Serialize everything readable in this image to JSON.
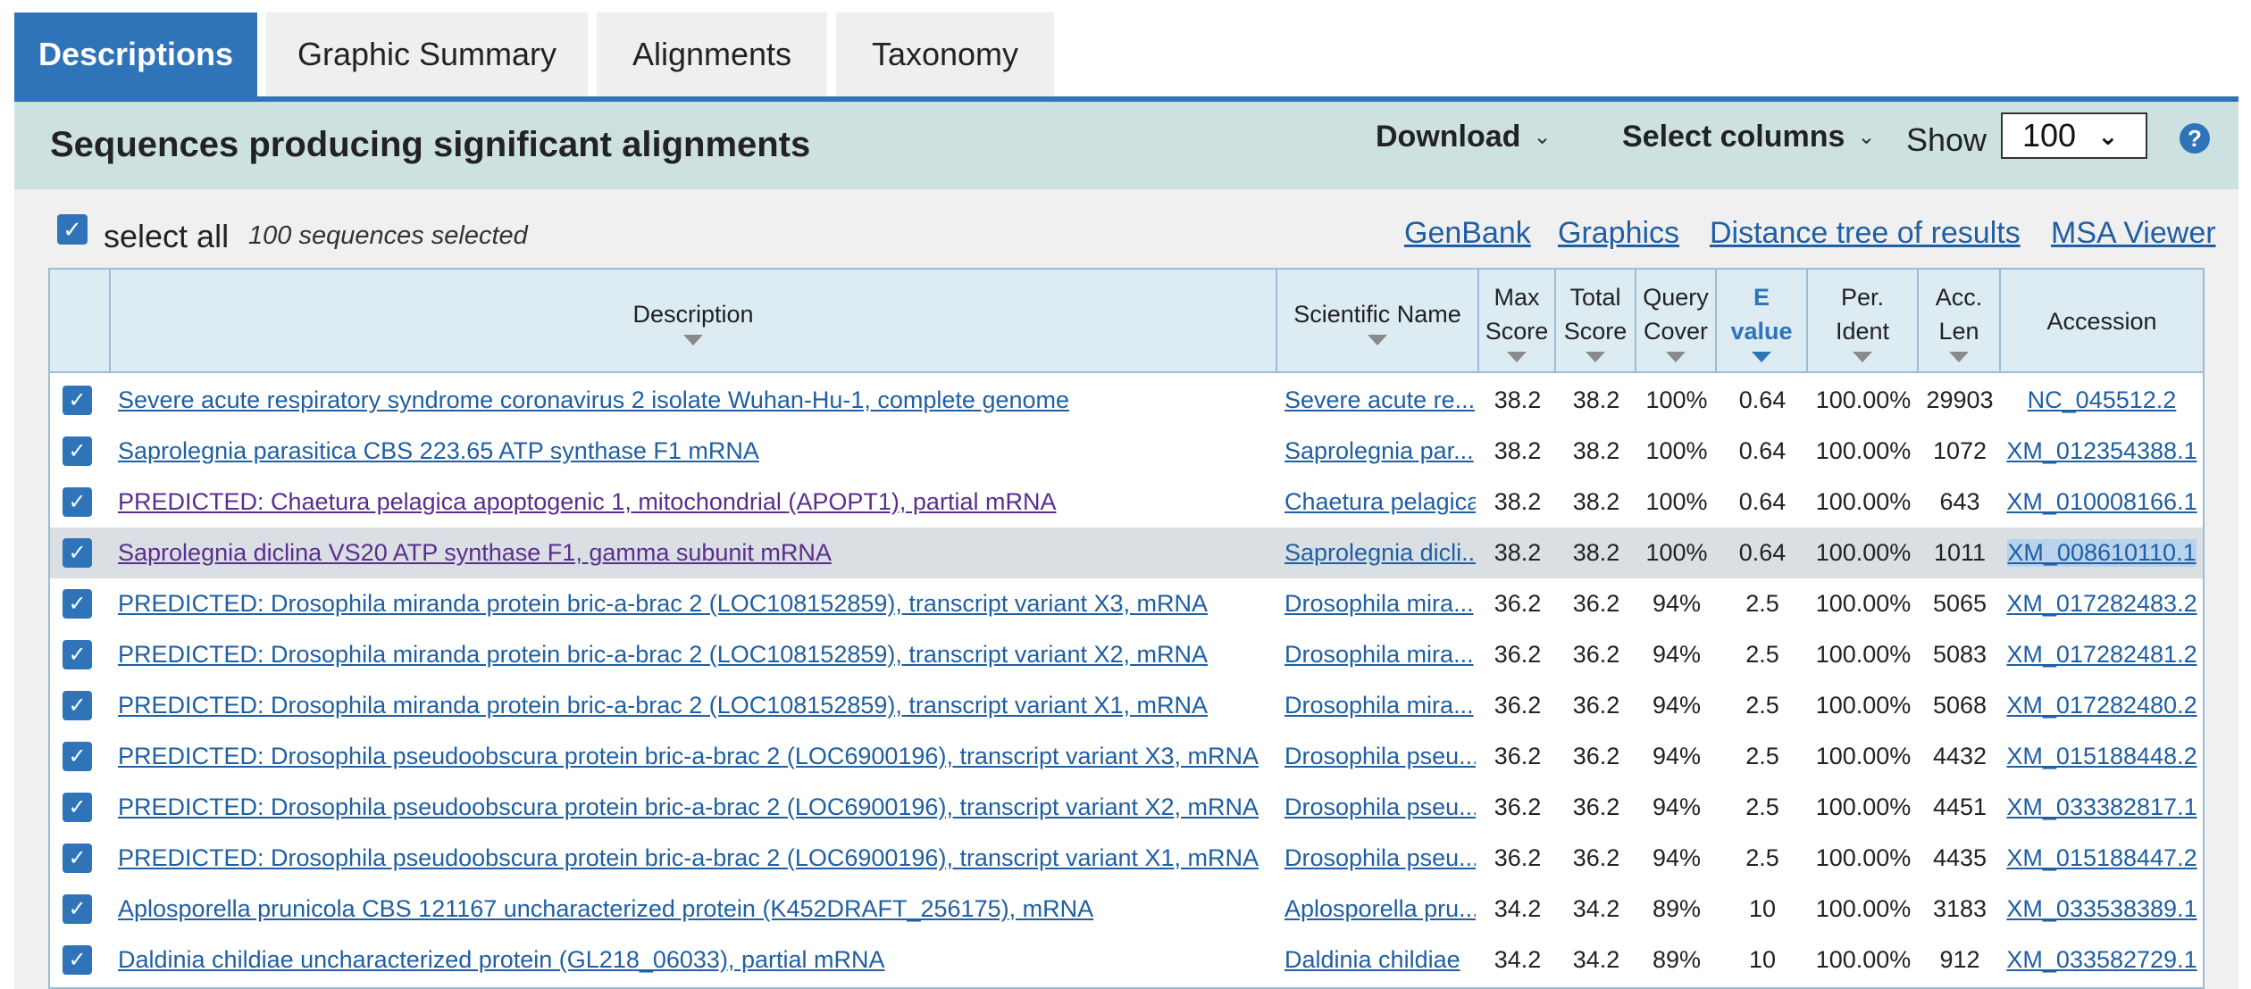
{
  "tabs": [
    {
      "label": "Descriptions",
      "active": true
    },
    {
      "label": "Graphic Summary",
      "active": false
    },
    {
      "label": "Alignments",
      "active": false
    },
    {
      "label": "Taxonomy",
      "active": false
    }
  ],
  "header": {
    "title": "Sequences producing significant alignments",
    "download_label": "Download",
    "select_columns_label": "Select columns",
    "show_label": "Show",
    "show_value": "100",
    "help": "?"
  },
  "selection": {
    "select_all_label": "select all",
    "selected_count_text": "100 sequences selected"
  },
  "top_links": [
    "GenBank",
    "Graphics",
    "Distance tree of results",
    "MSA Viewer"
  ],
  "columns": {
    "description": "Description",
    "scientific_name": "Scientific Name",
    "max_score": [
      "Max",
      "Score"
    ],
    "total_score": [
      "Total",
      "Score"
    ],
    "query_cover": [
      "Query",
      "Cover"
    ],
    "e_value": [
      "E",
      "value"
    ],
    "per_ident": [
      "Per.",
      "Ident"
    ],
    "acc_len": [
      "Acc.",
      "Len"
    ],
    "accession": "Accession"
  },
  "rows": [
    {
      "description": "Severe acute respiratory syndrome coronavirus 2 isolate Wuhan-Hu-1, complete genome",
      "scientific_name": "Severe acute re...",
      "max_score": "38.2",
      "total_score": "38.2",
      "query_cover": "100%",
      "e_value": "0.64",
      "per_ident": "100.00%",
      "acc_len": "29903",
      "accession": "NC_045512.2"
    },
    {
      "description": "Saprolegnia parasitica CBS 223.65 ATP synthase F1 mRNA",
      "scientific_name": "Saprolegnia par...",
      "max_score": "38.2",
      "total_score": "38.2",
      "query_cover": "100%",
      "e_value": "0.64",
      "per_ident": "100.00%",
      "acc_len": "1072",
      "accession": "XM_012354388.1"
    },
    {
      "description": "PREDICTED: Chaetura pelagica apoptogenic 1, mitochondrial (APOPT1), partial mRNA",
      "scientific_name": "Chaetura pelagica",
      "max_score": "38.2",
      "total_score": "38.2",
      "query_cover": "100%",
      "e_value": "0.64",
      "per_ident": "100.00%",
      "acc_len": "643",
      "accession": "XM_010008166.1"
    },
    {
      "description": "Saprolegnia diclina VS20 ATP synthase F1, gamma subunit mRNA",
      "scientific_name": "Saprolegnia dicli...",
      "max_score": "38.2",
      "total_score": "38.2",
      "query_cover": "100%",
      "e_value": "0.64",
      "per_ident": "100.00%",
      "acc_len": "1011",
      "accession": "XM_008610110.1"
    },
    {
      "description": "PREDICTED: Drosophila miranda protein bric-a-brac 2 (LOC108152859), transcript variant X3, mRNA",
      "scientific_name": "Drosophila mira...",
      "max_score": "36.2",
      "total_score": "36.2",
      "query_cover": "94%",
      "e_value": "2.5",
      "per_ident": "100.00%",
      "acc_len": "5065",
      "accession": "XM_017282483.2"
    },
    {
      "description": "PREDICTED: Drosophila miranda protein bric-a-brac 2 (LOC108152859), transcript variant X2, mRNA",
      "scientific_name": "Drosophila mira...",
      "max_score": "36.2",
      "total_score": "36.2",
      "query_cover": "94%",
      "e_value": "2.5",
      "per_ident": "100.00%",
      "acc_len": "5083",
      "accession": "XM_017282481.2"
    },
    {
      "description": "PREDICTED: Drosophila miranda protein bric-a-brac 2 (LOC108152859), transcript variant X1, mRNA",
      "scientific_name": "Drosophila mira...",
      "max_score": "36.2",
      "total_score": "36.2",
      "query_cover": "94%",
      "e_value": "2.5",
      "per_ident": "100.00%",
      "acc_len": "5068",
      "accession": "XM_017282480.2"
    },
    {
      "description": "PREDICTED: Drosophila pseudoobscura protein bric-a-brac 2 (LOC6900196), transcript variant X3, mRNA",
      "scientific_name": "Drosophila pseu...",
      "max_score": "36.2",
      "total_score": "36.2",
      "query_cover": "94%",
      "e_value": "2.5",
      "per_ident": "100.00%",
      "acc_len": "4432",
      "accession": "XM_015188448.2"
    },
    {
      "description": "PREDICTED: Drosophila pseudoobscura protein bric-a-brac 2 (LOC6900196), transcript variant X2, mRNA",
      "scientific_name": "Drosophila pseu...",
      "max_score": "36.2",
      "total_score": "36.2",
      "query_cover": "94%",
      "e_value": "2.5",
      "per_ident": "100.00%",
      "acc_len": "4451",
      "accession": "XM_033382817.1"
    },
    {
      "description": "PREDICTED: Drosophila pseudoobscura protein bric-a-brac 2 (LOC6900196), transcript variant X1, mRNA",
      "scientific_name": "Drosophila pseu...",
      "max_score": "36.2",
      "total_score": "36.2",
      "query_cover": "94%",
      "e_value": "2.5",
      "per_ident": "100.00%",
      "acc_len": "4435",
      "accession": "XM_015188447.2"
    },
    {
      "description": "Aplosporella prunicola CBS 121167 uncharacterized protein (K452DRAFT_256175), mRNA",
      "scientific_name": "Aplosporella pru...",
      "max_score": "34.2",
      "total_score": "34.2",
      "query_cover": "89%",
      "e_value": "10",
      "per_ident": "100.00%",
      "acc_len": "3183",
      "accession": "XM_033538389.1"
    },
    {
      "description": "Daldinia childiae uncharacterized protein (GL218_06033), partial mRNA",
      "scientific_name": "Daldinia childiae",
      "max_score": "34.2",
      "total_score": "34.2",
      "query_cover": "89%",
      "e_value": "10",
      "per_ident": "100.00%",
      "acc_len": "912",
      "accession": "XM_033582729.1"
    }
  ],
  "colors": {
    "accent": "#2f74b9",
    "header_band": "#cde2e0",
    "link": "#1f5fa3",
    "visited_link": "#5b2d8e",
    "highlight_row": "#d9dfe3"
  }
}
